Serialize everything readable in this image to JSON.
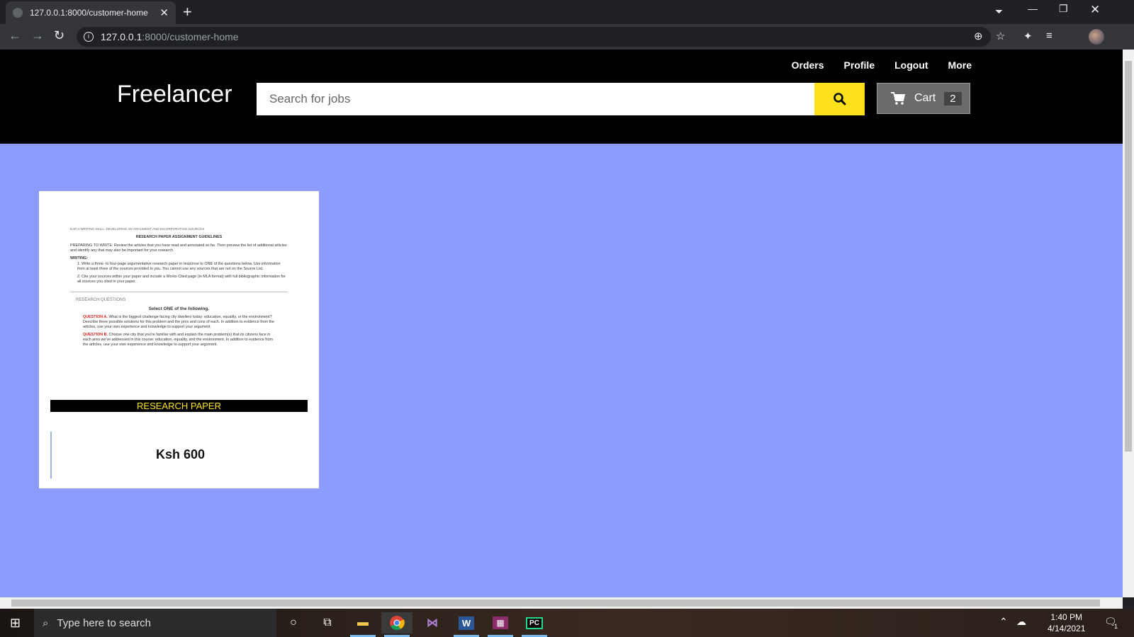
{
  "browser": {
    "tab_title": "127.0.0.1:8000/customer-home",
    "url_host": "127.0.0.1",
    "url_rest": ":8000/customer-home"
  },
  "site": {
    "brand": "Freelancer",
    "nav": [
      "Orders",
      "Profile",
      "Logout",
      "More"
    ],
    "search_placeholder": "Search for jobs",
    "cart_label": "Cart",
    "cart_count": "2"
  },
  "card": {
    "banner": "RESEARCH PAPER",
    "price": "Ksh 600",
    "doc": {
      "header": "EAP II  WRITING SKILL: DEVELOPING AN ARGUMENT AND INCORPORATING SOURCES",
      "title": "RESEARCH PAPER ASSIGNMENT GUIDELINES",
      "prep": "PREPARING TO WRITE: Review the articles that you have read and annotated so far. Then preview the list of additional articles and identify any that may also be important for your research.",
      "writing_label": "WRITING:",
      "item1": "1.  Write a three- to four-page argumentative research paper in response to ONE of the questions below. Use information from at least three of the sources provided to you. You cannot use any sources that are not on the Source List.",
      "item2": "2.  Cite your sources within your paper and include a Works Cited page (in MLA format) with full bibliographic information for all sources you cited in your paper.",
      "rq_label": "RESEARCH QUESTIONS",
      "select": "Select ONE of the following.",
      "qa_label": "QUESTION A.",
      "qa": "What is the biggest challenge facing city dwellers today: education, equality, or the environment? Describe three possible solutions for this problem and the pros and cons of each. In addition to evidence from the articles, use your own experience and knowledge to support your argument.",
      "qb_label": "QUESTION B.",
      "qb": "Choose one city that you're familiar with and explain the main problem(s) that its citizens face in each area we've addressed in this course: education, equality, and the environment. In addition to evidence from the articles, use your own experience and knowledge to support your argument."
    }
  },
  "taskbar": {
    "search_placeholder": "Type here to search",
    "time": "1:40 PM",
    "date": "4/14/2021",
    "notif_count": "1"
  }
}
